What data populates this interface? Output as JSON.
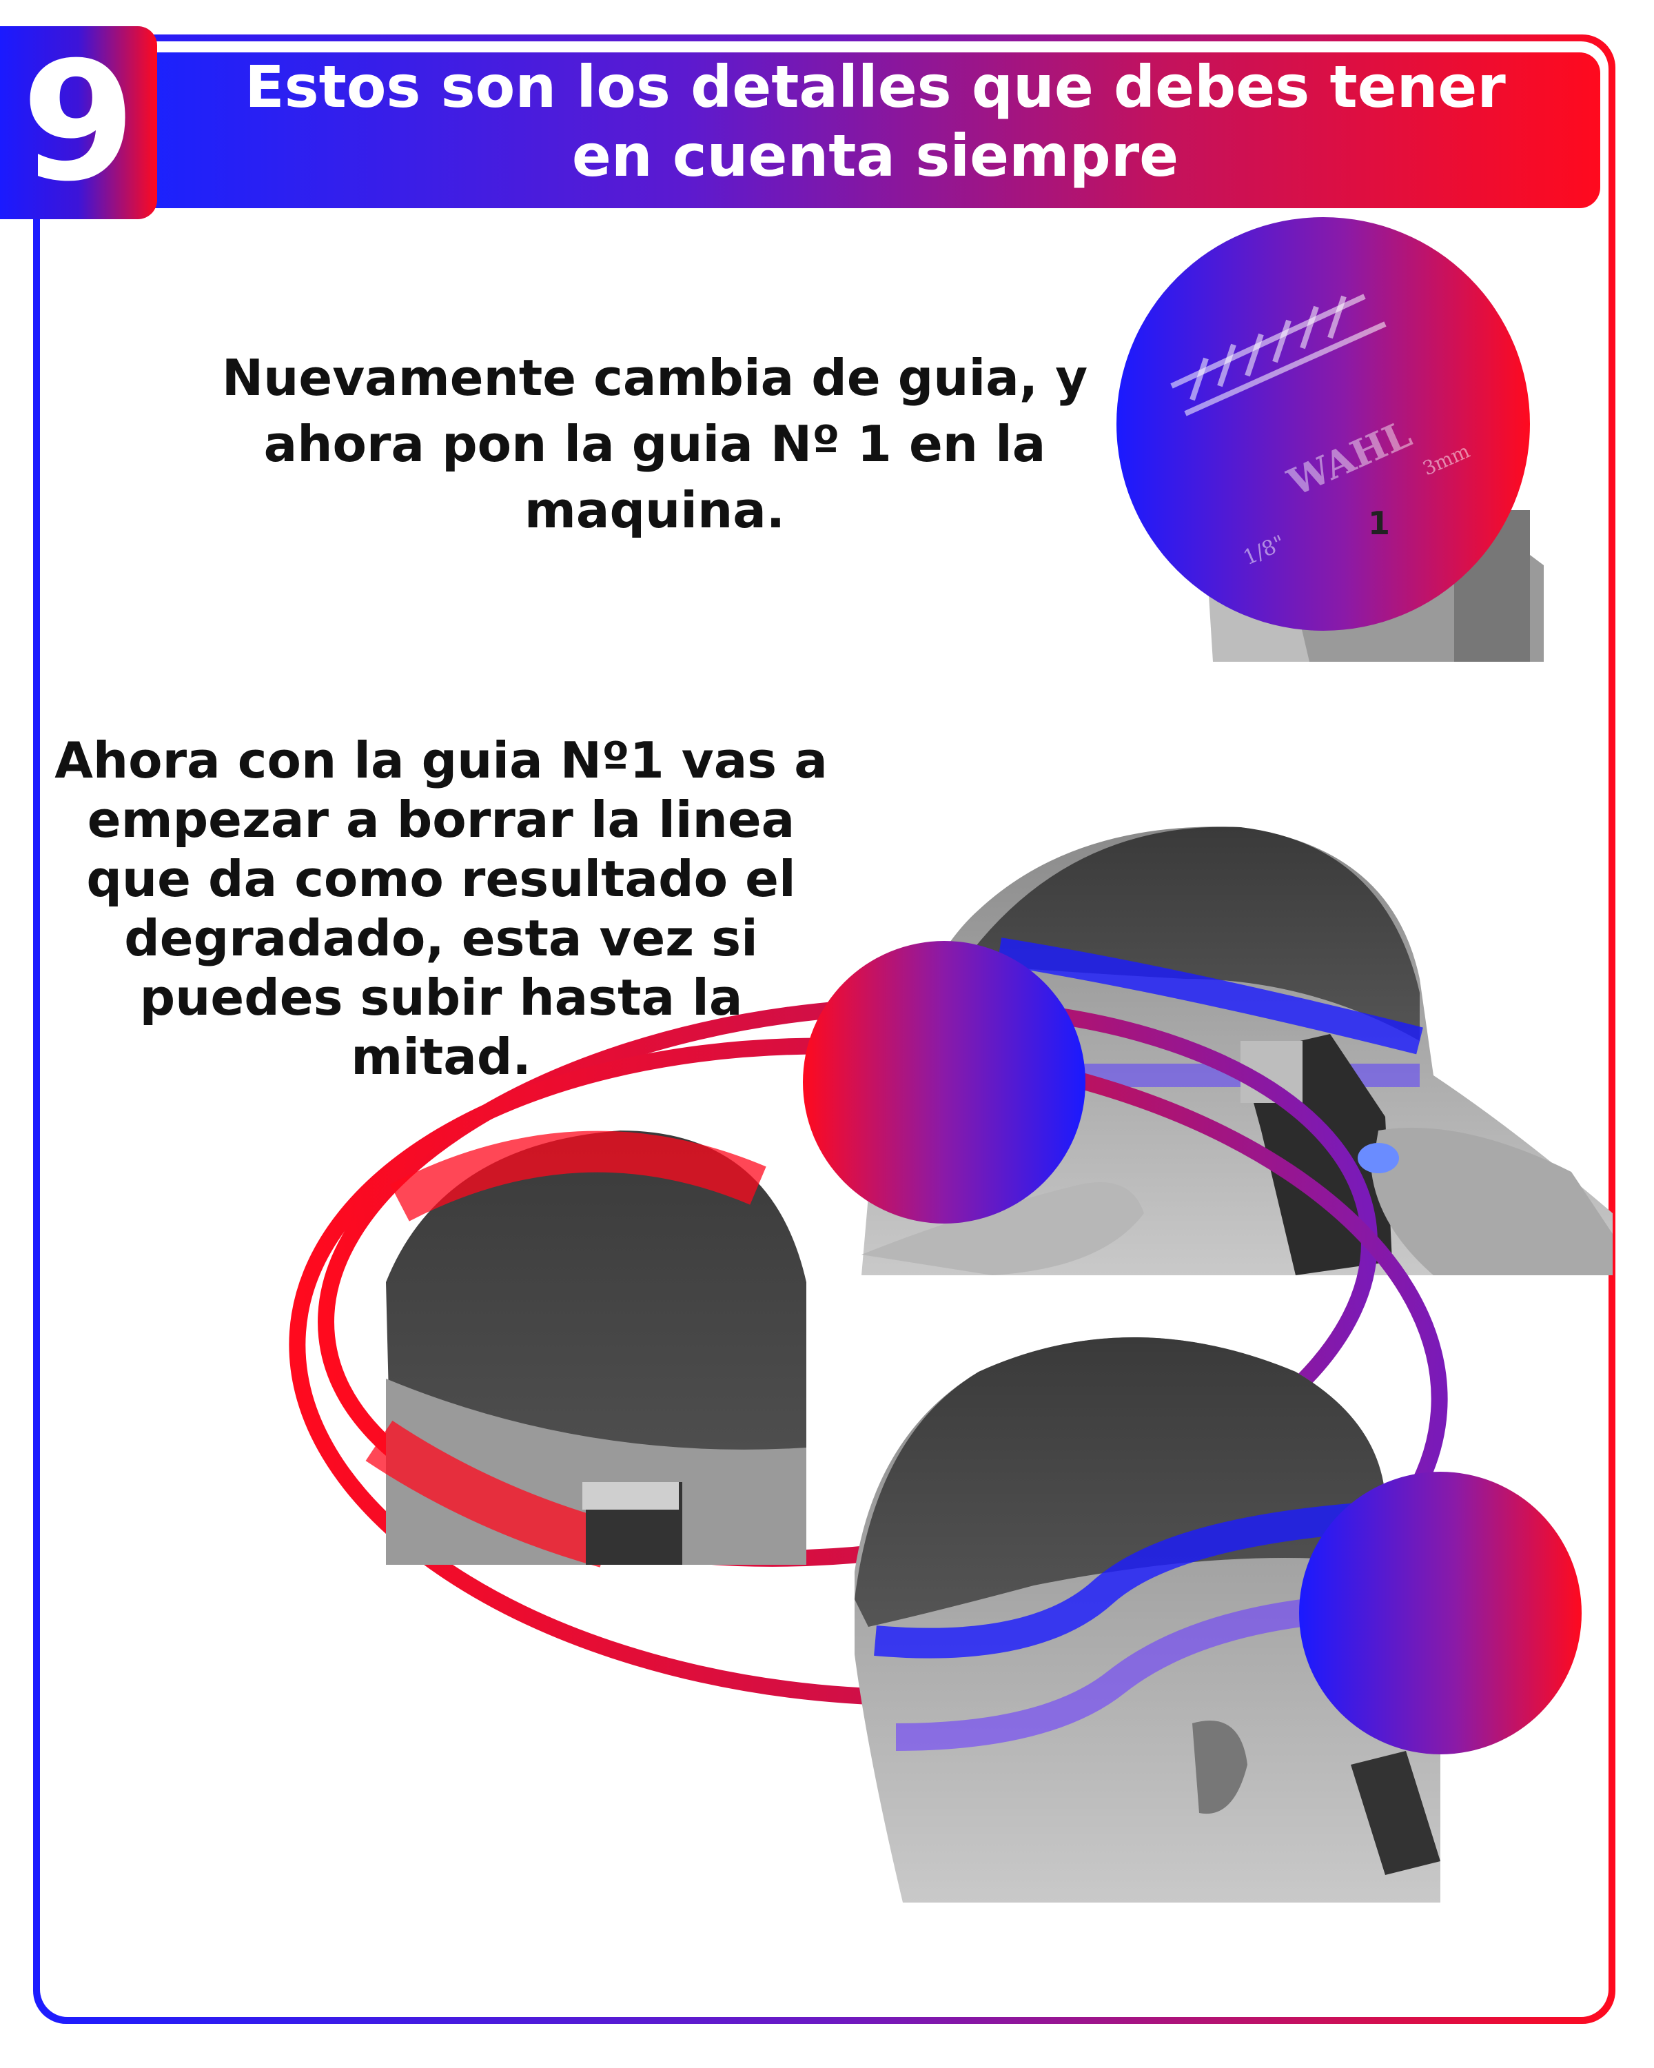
{
  "badge": {
    "number": "9"
  },
  "header": {
    "title_line1": "Estos son los detalles que debes tener",
    "title_line2": "en cuenta siempre"
  },
  "step1": {
    "lines": [
      "Nuevamente cambia de guia, y",
      "ahora pon la guia Nº 1 en la",
      "maquina."
    ]
  },
  "step2": {
    "lines": [
      "Ahora con la guia Nº1 vas a",
      "empezar a borrar la linea",
      "que da como resultado el",
      "degradado, esta vez si",
      "puedes subir hasta la",
      "mitad."
    ]
  },
  "guard_labels": {
    "brand": "WAHL",
    "size": "1",
    "inch": "1/8\"",
    "mm": "3mm"
  },
  "colors": {
    "blue": "#1a1aff",
    "purple": "#7a1ab8",
    "red": "#ff0a1e"
  },
  "icons": [
    "clipper-guard-photo-icon",
    "head-back-photo-icon",
    "head-crown-photo-icon",
    "head-side-photo-icon"
  ]
}
